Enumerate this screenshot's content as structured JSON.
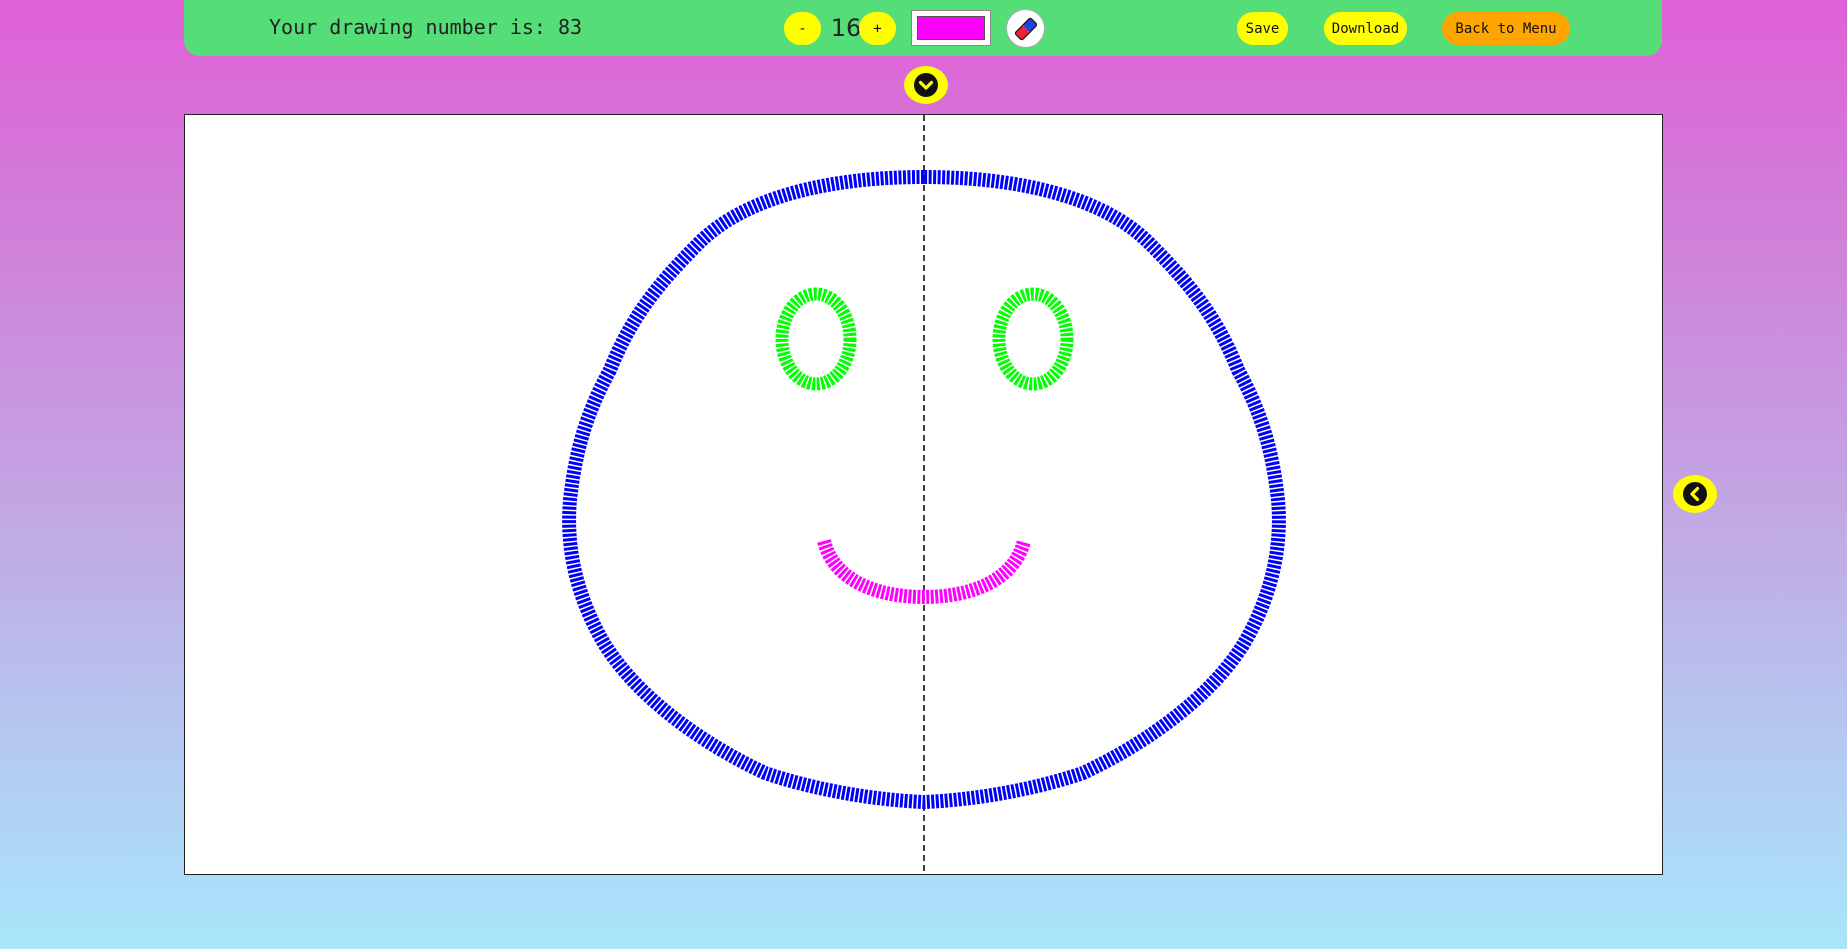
{
  "header": {
    "drawing_label": "Your drawing number is: 83",
    "brush": {
      "decrease_label": "-",
      "size_value": "16",
      "increase_label": "+"
    },
    "current_color": "#ff00ff",
    "eraser_icon": "eraser-icon",
    "save_label": "Save",
    "download_label": "Download",
    "menu_label": "Back to Menu"
  },
  "panel_toggles": {
    "top_icon": "chevron-down-icon",
    "right_icon": "chevron-left-icon"
  },
  "canvas": {
    "symmetry_guide": "vertical dashed center line",
    "strokes": [
      {
        "name": "face-outline",
        "color": "#0000ff"
      },
      {
        "name": "left-eye",
        "color": "#00ff00"
      },
      {
        "name": "right-eye",
        "color": "#00ff00"
      },
      {
        "name": "mouth",
        "color": "#ff00ff"
      }
    ]
  },
  "colors": {
    "toolbar": "#55dd77",
    "button_yellow": "#ffff00",
    "button_orange": "#ffa500"
  }
}
